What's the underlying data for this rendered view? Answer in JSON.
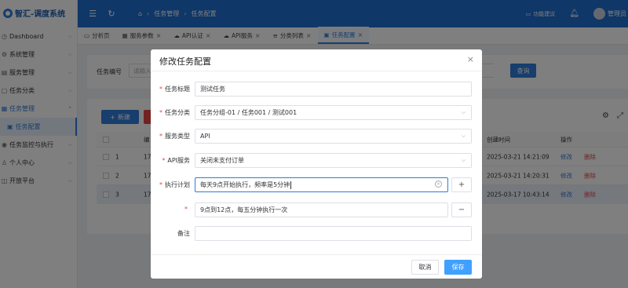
{
  "app": {
    "title": "智汇-调度系统"
  },
  "sidebar": {
    "items": [
      {
        "label": "Dashboard",
        "icon": "dashboard-icon"
      },
      {
        "label": "系统管理",
        "icon": "gear-icon"
      },
      {
        "label": "服务管理",
        "icon": "server-icon"
      },
      {
        "label": "任务分类",
        "icon": "folder-icon"
      },
      {
        "label": "任务管理",
        "icon": "list-icon"
      },
      {
        "label": "任务配置",
        "icon": "doc-icon"
      },
      {
        "label": "任务监控与执行",
        "icon": "monitor-icon"
      },
      {
        "label": "个人中心",
        "icon": "user-icon"
      },
      {
        "label": "开放平台",
        "icon": "box-icon"
      }
    ]
  },
  "header": {
    "breadcrumb": [
      "任务管理",
      "任务配置"
    ],
    "feedback": "功能建议",
    "user": "管理员"
  },
  "tabs": [
    {
      "label": "分析页"
    },
    {
      "label": "服务参数"
    },
    {
      "label": "API认证"
    },
    {
      "label": "API服务"
    },
    {
      "label": "分类列表"
    },
    {
      "label": "任务配置"
    }
  ],
  "search": {
    "label": "任务编号",
    "placeholder": "请输入",
    "button": "查询"
  },
  "table": {
    "new_button": "新建",
    "columns": {
      "name_short": "编",
      "created": "创建时间",
      "ops": "操作"
    },
    "rows": [
      {
        "idx": "1",
        "code": "17",
        "created": "2025-03-21 14:21:09",
        "edit": "修改",
        "del": "删除"
      },
      {
        "idx": "2",
        "code": "17",
        "created": "2025-03-21 14:20:31",
        "edit": "修改",
        "del": "删除"
      },
      {
        "idx": "3",
        "code": "17",
        "created": "2025-03-17 10:43:14",
        "edit": "修改",
        "del": "删除"
      }
    ]
  },
  "modal": {
    "title": "修改任务配置",
    "fields": {
      "title": {
        "label": "任务标题",
        "value": "测试任务"
      },
      "category": {
        "label": "任务分类",
        "value": "任务分组-01 / 任务001 / 测试001"
      },
      "service_type": {
        "label": "服务类型",
        "value": "API"
      },
      "api_service": {
        "label": "API服务",
        "value": "关闭未支付订单"
      },
      "schedule": {
        "label": "执行计划",
        "value": "每天9点开始执行，频率是5分钟"
      },
      "schedule_extra": {
        "value": "9点到12点，每五分钟执行一次"
      },
      "remark": {
        "label": "备注",
        "value": ""
      }
    },
    "cancel": "取消",
    "save": "保存"
  }
}
